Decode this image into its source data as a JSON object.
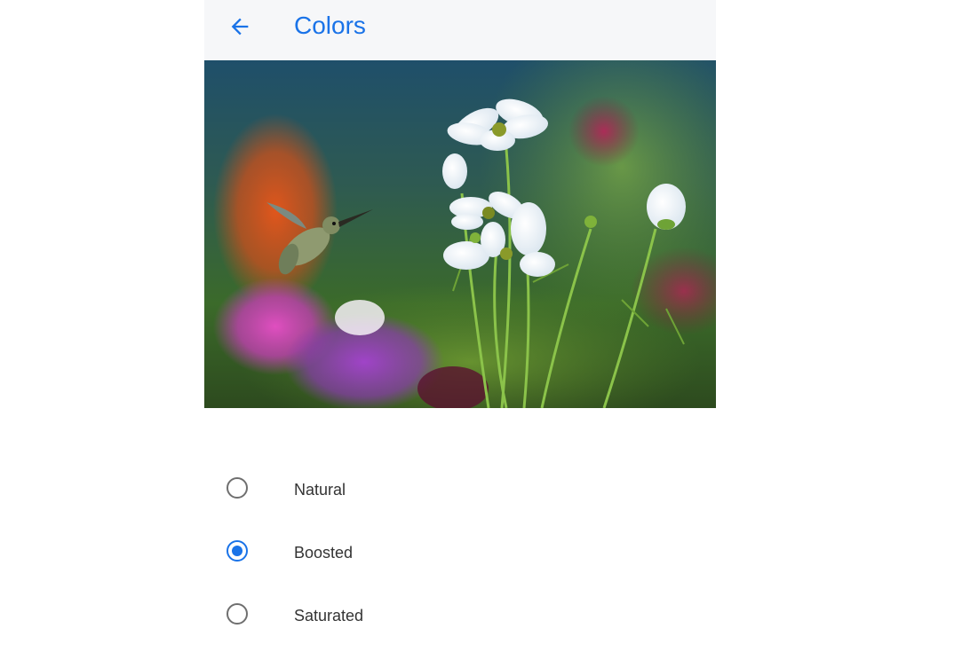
{
  "header": {
    "title": "Colors",
    "back_icon": "arrow-back-icon"
  },
  "preview": {
    "image": "hummingbird-and-white-cosmos-flowers"
  },
  "color_modes": {
    "selected": "Boosted",
    "options": [
      {
        "label": "Natural",
        "checked": false
      },
      {
        "label": "Boosted",
        "checked": true
      },
      {
        "label": "Saturated",
        "checked": false
      }
    ]
  },
  "colors": {
    "accent": "#1a73e8",
    "toolbar_bg": "#f6f7f9",
    "radio_unchecked": "#6f6f6f",
    "text": "#333333"
  }
}
